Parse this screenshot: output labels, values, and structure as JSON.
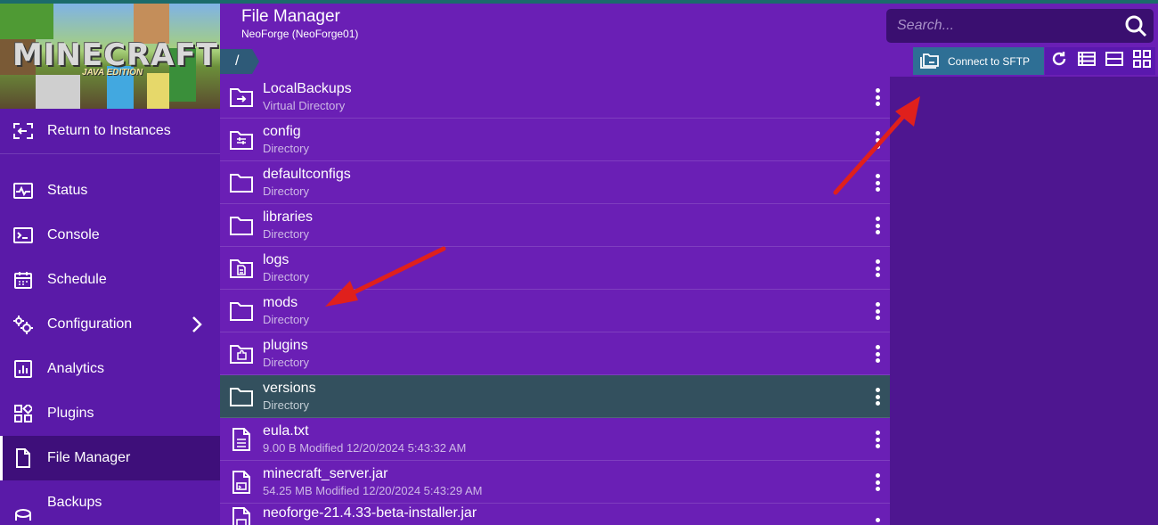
{
  "header": {
    "title": "File Manager",
    "subtitle": "NeoForge (NeoForge01)"
  },
  "search": {
    "placeholder": "Search..."
  },
  "breadcrumb": {
    "path": "/"
  },
  "toolbar": {
    "sftp_label": "Connect to SFTP"
  },
  "banner": {
    "logo": "MINECRAFT",
    "edition": "JAVA EDITION"
  },
  "sidebar": {
    "items": [
      {
        "label": "Return to Instances"
      },
      {
        "label": "Status"
      },
      {
        "label": "Console"
      },
      {
        "label": "Schedule"
      },
      {
        "label": "Configuration"
      },
      {
        "label": "Analytics"
      },
      {
        "label": "Plugins"
      },
      {
        "label": "File Manager"
      },
      {
        "label": "Backups"
      }
    ]
  },
  "files": [
    {
      "name": "LocalBackups",
      "meta": "Virtual Directory",
      "icon": "folder-link-icon"
    },
    {
      "name": "config",
      "meta": "Directory",
      "icon": "folder-settings-icon"
    },
    {
      "name": "defaultconfigs",
      "meta": "Directory",
      "icon": "folder-icon"
    },
    {
      "name": "libraries",
      "meta": "Directory",
      "icon": "folder-icon"
    },
    {
      "name": "logs",
      "meta": "Directory",
      "icon": "folder-document-icon"
    },
    {
      "name": "mods",
      "meta": "Directory",
      "icon": "folder-icon"
    },
    {
      "name": "plugins",
      "meta": "Directory",
      "icon": "folder-plugin-icon"
    },
    {
      "name": "versions",
      "meta": "Directory",
      "icon": "folder-icon"
    },
    {
      "name": "eula.txt",
      "meta": "9.00 B Modified 12/20/2024 5:43:32 AM",
      "icon": "text-file-icon"
    },
    {
      "name": "minecraft_server.jar",
      "meta": "54.25 MB Modified 12/20/2024 5:43:29 AM",
      "icon": "jar-file-icon"
    },
    {
      "name": "neoforge-21.4.33-beta-installer.jar",
      "meta": "",
      "icon": "jar-file-icon"
    }
  ],
  "colors": {
    "primary": "#6a1fb5",
    "sidebar": "#5a1aa8",
    "active_nav": "#3e0f7a",
    "highlight_row": "#33505e",
    "sftp_button": "#2e6f95",
    "annotation_arrow": "#e0201c"
  }
}
